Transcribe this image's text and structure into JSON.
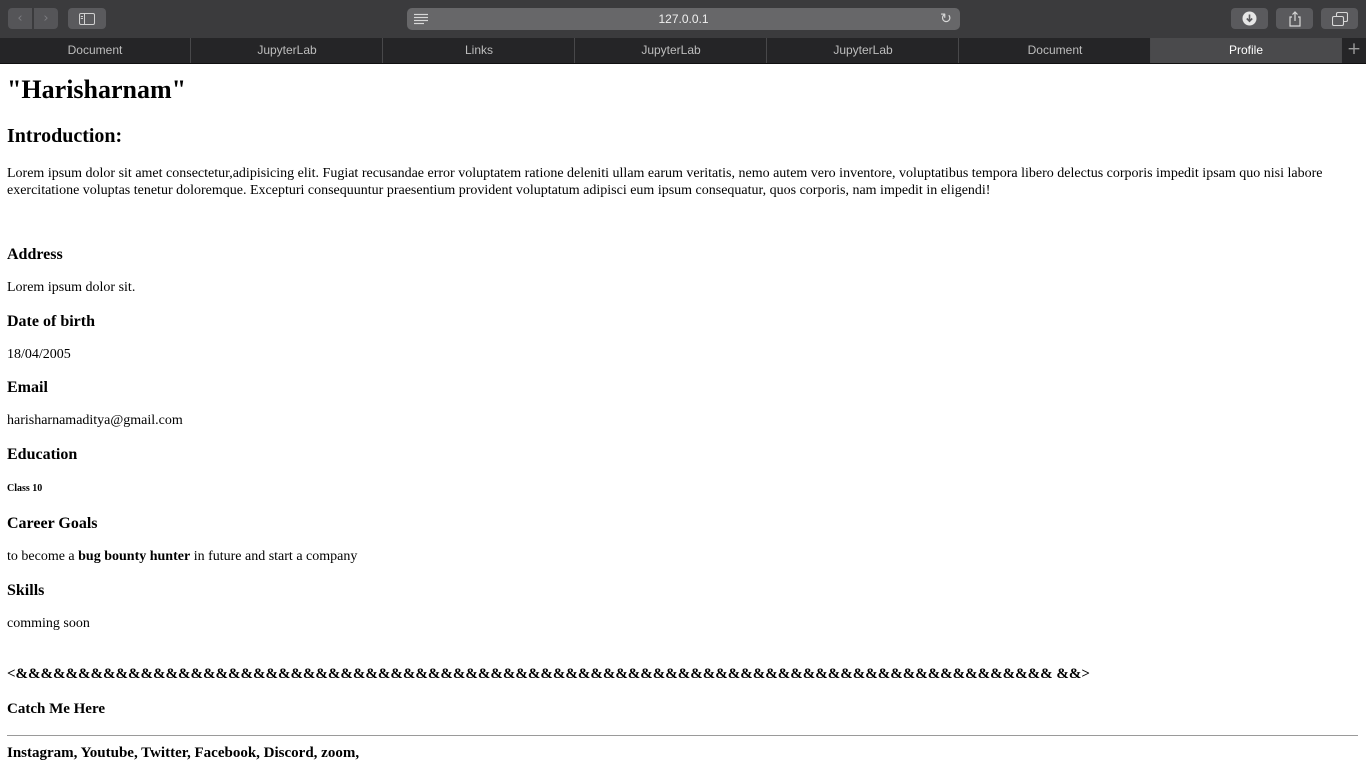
{
  "browser": {
    "url": "127.0.0.1",
    "tabs": [
      {
        "label": "Document"
      },
      {
        "label": "JupyterLab"
      },
      {
        "label": "Links"
      },
      {
        "label": "JupyterLab"
      },
      {
        "label": "JupyterLab"
      },
      {
        "label": "Document"
      },
      {
        "label": "Profile"
      }
    ],
    "active_tab": "Profile",
    "new_tab_label": "+"
  },
  "page": {
    "title": "\"Harisharnam\"",
    "intro_heading": "Introduction:",
    "intro_text": "Lorem ipsum dolor sit amet consectetur,adipisicing elit. Fugiat recusandae error voluptatem ratione deleniti ullam earum veritatis, nemo autem vero inventore, voluptatibus tempora libero delectus corporis impedit ipsam quo nisi labore exercitatione voluptas tenetur doloremque. Excepturi consequuntur praesentium provident voluptatum adipisci eum ipsum consequatur, quos corporis, nam impedit in eligendi!",
    "address_heading": "Address",
    "address_value": "Lorem ipsum dolor sit.",
    "dob_heading": "Date of birth",
    "dob_value": "18/04/2005",
    "email_heading": "Email",
    "email_value": "harisharnamaditya@gmail.com",
    "education_heading": "Education",
    "education_value": "Class 10",
    "career_heading": "Career Goals",
    "career_pre": "to become a ",
    "career_bold": "bug bounty hunter",
    "career_post": " in future and start a company",
    "skills_heading": "Skills",
    "skills_value": "comming soon",
    "divider_text": "<&&&&&&&&&&&&&&&&&&&&&&&&&&&&&&&&&&&&&&&&&&&&&&&&&&&&&&&&&&&&&&&&&&&&&&&&&&&&&&&&&&& &&>",
    "catch_heading": "Catch Me Here",
    "social_links": "Instagram, Youtube, Twitter, Facebook, Discord, zoom,"
  }
}
